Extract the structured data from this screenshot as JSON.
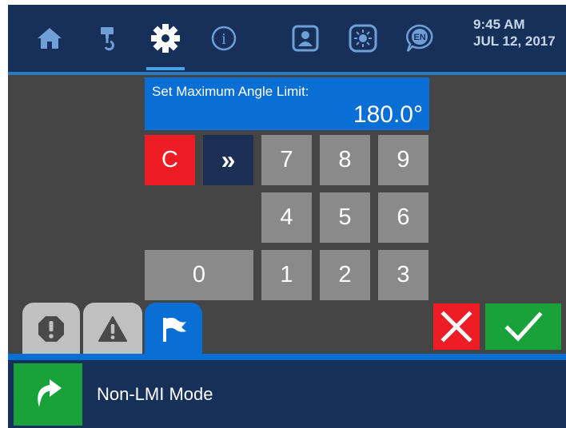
{
  "nav": {
    "items": [
      {
        "icon": "home-icon",
        "active": false
      },
      {
        "icon": "crane-hook-icon",
        "active": false
      },
      {
        "icon": "gear-icon",
        "active": true
      },
      {
        "icon": "info-icon",
        "active": false
      },
      {
        "icon": "operator-profile-icon",
        "active": false
      },
      {
        "icon": "brightness-icon",
        "active": false
      },
      {
        "icon": "language-icon",
        "active": false
      }
    ],
    "language_badge": "EN",
    "info_glyph": "i",
    "time": "9:45 AM",
    "date": "JUL 12, 2017"
  },
  "entry": {
    "label": "Set Maximum Angle Limit:",
    "value": "180.0°"
  },
  "keypad": {
    "clear": "C",
    "next": "»",
    "digits": [
      "7",
      "8",
      "9",
      "4",
      "5",
      "6",
      "1",
      "2",
      "3",
      "0"
    ]
  },
  "tabs": [
    {
      "icon": "alarm-octagon-icon",
      "active": false
    },
    {
      "icon": "warning-triangle-icon",
      "active": false
    },
    {
      "icon": "flag-icon",
      "active": true
    }
  ],
  "actions": {
    "cancel_icon": "close-icon",
    "confirm_icon": "checkmark-icon"
  },
  "status": {
    "mode_icon": "mode-arrow-icon",
    "mode_label": "Non-LMI Mode"
  },
  "colors": {
    "nav_bar": "#17305a",
    "accent_blue": "#0a6fd4",
    "panel": "#454545",
    "key": "#8a8a8a",
    "clear_red": "#ee1c24",
    "confirm_green": "#19a13a",
    "next_navy": "#1c2f55"
  }
}
